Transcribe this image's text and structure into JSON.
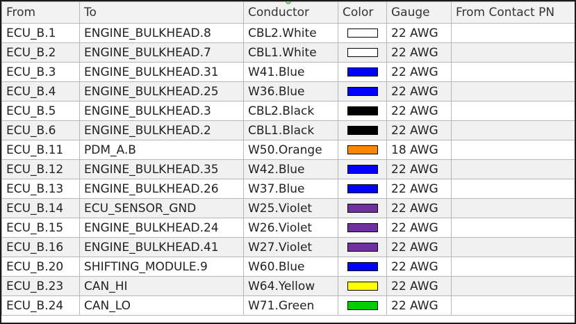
{
  "table": {
    "columns": [
      "From",
      "To",
      "Conductor",
      "Color",
      "Gauge",
      "From Contact PN"
    ],
    "rows": [
      {
        "from": "ECU_B.1",
        "to": "ENGINE_BULKHEAD.8",
        "conductor": "CBL2.White",
        "color": "#ffffff",
        "gauge": "22 AWG",
        "from_contact_pn": ""
      },
      {
        "from": "ECU_B.2",
        "to": "ENGINE_BULKHEAD.7",
        "conductor": "CBL1.White",
        "color": "#ffffff",
        "gauge": "22 AWG",
        "from_contact_pn": ""
      },
      {
        "from": "ECU_B.3",
        "to": "ENGINE_BULKHEAD.31",
        "conductor": "W41.Blue",
        "color": "#0000ff",
        "gauge": "22 AWG",
        "from_contact_pn": ""
      },
      {
        "from": "ECU_B.4",
        "to": "ENGINE_BULKHEAD.25",
        "conductor": "W36.Blue",
        "color": "#0000ff",
        "gauge": "22 AWG",
        "from_contact_pn": ""
      },
      {
        "from": "ECU_B.5",
        "to": "ENGINE_BULKHEAD.3",
        "conductor": "CBL2.Black",
        "color": "#000000",
        "gauge": "22 AWG",
        "from_contact_pn": ""
      },
      {
        "from": "ECU_B.6",
        "to": "ENGINE_BULKHEAD.2",
        "conductor": "CBL1.Black",
        "color": "#000000",
        "gauge": "22 AWG",
        "from_contact_pn": ""
      },
      {
        "from": "ECU_B.11",
        "to": "PDM_A.B",
        "conductor": "W50.Orange",
        "color": "#ff8800",
        "gauge": "18 AWG",
        "from_contact_pn": ""
      },
      {
        "from": "ECU_B.12",
        "to": "ENGINE_BULKHEAD.35",
        "conductor": "W42.Blue",
        "color": "#0000ff",
        "gauge": "22 AWG",
        "from_contact_pn": ""
      },
      {
        "from": "ECU_B.13",
        "to": "ENGINE_BULKHEAD.26",
        "conductor": "W37.Blue",
        "color": "#0000ff",
        "gauge": "22 AWG",
        "from_contact_pn": ""
      },
      {
        "from": "ECU_B.14",
        "to": "ECU_SENSOR_GND",
        "conductor": "W25.Violet",
        "color": "#7030a0",
        "gauge": "22 AWG",
        "from_contact_pn": ""
      },
      {
        "from": "ECU_B.15",
        "to": "ENGINE_BULKHEAD.24",
        "conductor": "W26.Violet",
        "color": "#7030a0",
        "gauge": "22 AWG",
        "from_contact_pn": ""
      },
      {
        "from": "ECU_B.16",
        "to": "ENGINE_BULKHEAD.41",
        "conductor": "W27.Violet",
        "color": "#7030a0",
        "gauge": "22 AWG",
        "from_contact_pn": ""
      },
      {
        "from": "ECU_B.20",
        "to": "SHIFTING_MODULE.9",
        "conductor": "W60.Blue",
        "color": "#0000ff",
        "gauge": "22 AWG",
        "from_contact_pn": ""
      },
      {
        "from": "ECU_B.23",
        "to": "CAN_HI",
        "conductor": "W64.Yellow",
        "color": "#ffff00",
        "gauge": "22 AWG",
        "from_contact_pn": ""
      },
      {
        "from": "ECU_B.24",
        "to": "CAN_LO",
        "conductor": "W71.Green",
        "color": "#00cc00",
        "gauge": "22 AWG",
        "from_contact_pn": ""
      }
    ]
  }
}
